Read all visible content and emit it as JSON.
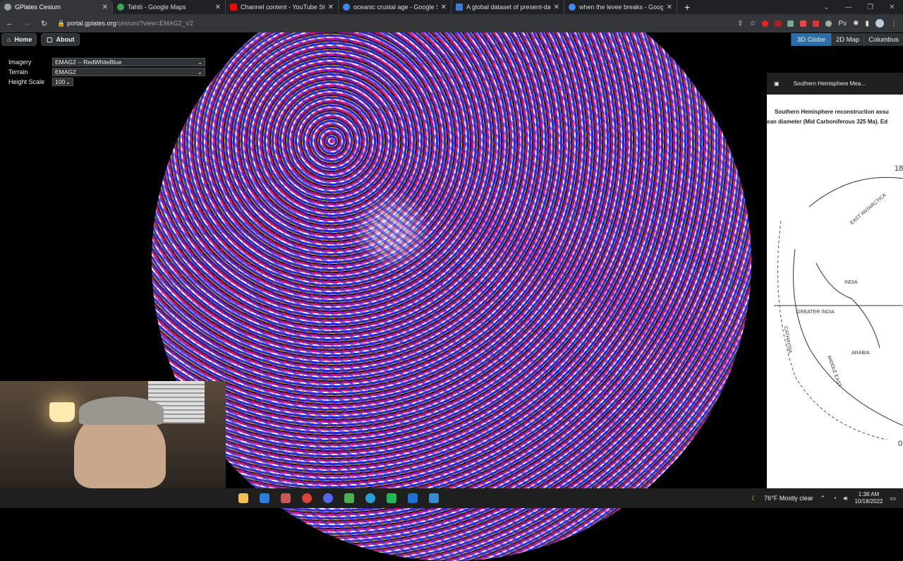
{
  "tabs": [
    {
      "title": "GPlates Cesium",
      "color": "#9aa0a6",
      "active": true
    },
    {
      "title": "Tahiti - Google Maps",
      "color": "#34a853"
    },
    {
      "title": "Channel content - YouTube Studio",
      "color": "#ff0000"
    },
    {
      "title": "oceanic crustal age - Google Search",
      "color": "#4285f4"
    },
    {
      "title": "A global dataset of present-day",
      "color": "#3a7bd5"
    },
    {
      "title": "when the levee breaks - Google",
      "color": "#4285f4"
    }
  ],
  "address": {
    "domain": "portal.gplates.org",
    "path": "/cesium/?view=EMAG2_V2"
  },
  "extensions": {
    "pv": "Pv"
  },
  "app": {
    "home": "Home",
    "about": "About",
    "imagery_label": "Imagery",
    "imagery_value": "EMAG2 -- RedWhiteBlue",
    "terrain_label": "Terrain",
    "terrain_value": "EMAG2",
    "height_label": "Height Scale",
    "height_value": "100",
    "modes": [
      "3D Globe",
      "2D Map",
      "Columbus"
    ]
  },
  "panel": {
    "title": "Southern Hemisphere Mea...",
    "caption1": "Southern Hemisphere  reconstruction assu",
    "caption2": "ean diameter (Mid Carboniferous 325 Ma). Ed",
    "labels": [
      "18",
      "EAST ANTARCTICA",
      "INDIA",
      "GREATER INDIA",
      "CATHAYSIA",
      "ARABIA",
      "MIDDLE EAST",
      "0"
    ]
  },
  "taskbar": {
    "weather": "76°F  Mostly clear",
    "time": "1:38 AM",
    "date": "10/18/2022"
  }
}
